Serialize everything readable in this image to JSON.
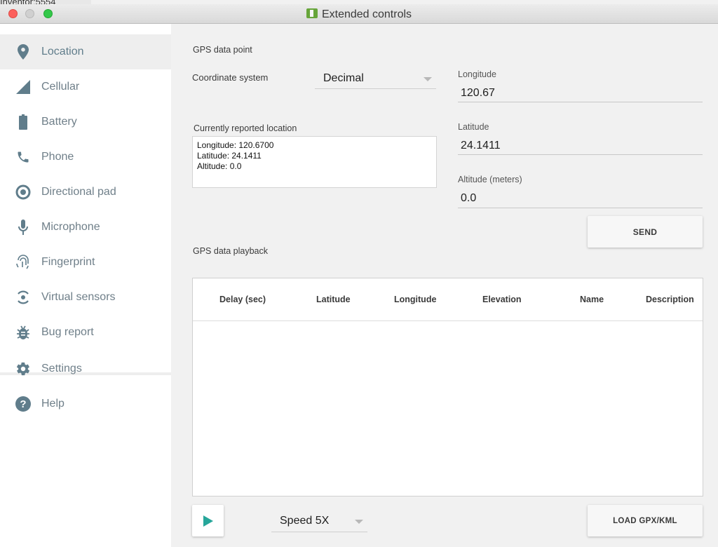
{
  "window": {
    "background_label": "Inventor:5554",
    "title": "Extended controls"
  },
  "sidebar": {
    "items": [
      {
        "label": "Location",
        "icon": "location-pin-icon"
      },
      {
        "label": "Cellular",
        "icon": "cellular-signal-icon"
      },
      {
        "label": "Battery",
        "icon": "battery-icon"
      },
      {
        "label": "Phone",
        "icon": "phone-icon"
      },
      {
        "label": "Directional pad",
        "icon": "dpad-icon"
      },
      {
        "label": "Microphone",
        "icon": "microphone-icon"
      },
      {
        "label": "Fingerprint",
        "icon": "fingerprint-icon"
      },
      {
        "label": "Virtual sensors",
        "icon": "virtual-sensors-icon"
      },
      {
        "label": "Bug report",
        "icon": "bug-icon"
      },
      {
        "label": "Settings",
        "icon": "gear-icon"
      },
      {
        "label": "Help",
        "icon": "help-icon"
      }
    ],
    "active": "Location"
  },
  "gps_point": {
    "section_title": "GPS data point",
    "coord_label": "Coordinate system",
    "coord_value": "Decimal",
    "reported_label": "Currently reported location",
    "reported_lines": [
      "Longitude: 120.6700",
      "Latitude: 24.1411",
      "Altitude: 0.0"
    ],
    "longitude_label": "Longitude",
    "longitude_value": "120.67",
    "latitude_label": "Latitude",
    "latitude_value": "24.1411",
    "altitude_label": "Altitude (meters)",
    "altitude_value": "0.0",
    "send_label": "SEND"
  },
  "playback": {
    "section_title": "GPS data playback",
    "columns": [
      "Delay (sec)",
      "Latitude",
      "Longitude",
      "Elevation",
      "Name",
      "Description"
    ],
    "speed_value": "Speed 5X",
    "load_label": "LOAD GPX/KML"
  },
  "colors": {
    "accent": "#26a69a",
    "icon": "#607d8b"
  }
}
